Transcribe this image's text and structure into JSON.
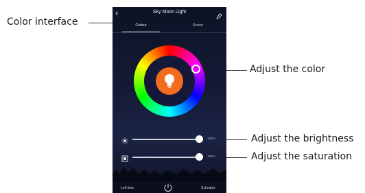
{
  "callouts": {
    "color_interface": "Color interface",
    "adjust_color": "Adjust the color",
    "adjust_brightness": "Adjust the brightness",
    "adjust_saturation": "Adjust the saturation"
  },
  "app": {
    "title": "Sky Moon Light",
    "tabs": [
      "Colour",
      "Scene"
    ],
    "active_tab": "Colour",
    "brightness": {
      "value_label": "100%",
      "level": 1.0
    },
    "saturation": {
      "value_label": "100%",
      "level": 1.0
    },
    "bottom": {
      "left_label": "Left time",
      "right_label": "Schedule"
    },
    "icons": [
      "back-icon",
      "edit-icon",
      "bulb-icon",
      "brightness-sun-icon",
      "saturation-square-icon",
      "power-icon"
    ],
    "colors": {
      "accent_orange": "#f26c1d",
      "background": "#141b36"
    }
  }
}
